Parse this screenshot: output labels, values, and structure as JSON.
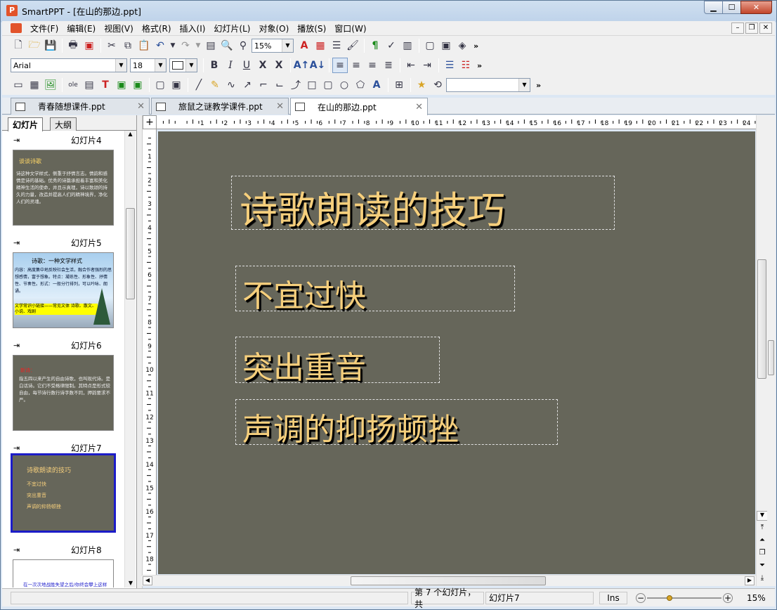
{
  "window": {
    "title": "SmartPPT - [在山的那边.ppt]",
    "app_icon": "P"
  },
  "caption_buttons": {
    "minimize": "▁",
    "maximize": "☐",
    "close": "✕"
  },
  "mdi_controls": [
    "–",
    "❐",
    "✕"
  ],
  "menu": [
    "文件(F)",
    "编辑(E)",
    "视图(V)",
    "格式(R)",
    "插入(I)",
    "幻灯片(L)",
    "对象(O)",
    "播放(S)",
    "窗口(W)"
  ],
  "toolbar": {
    "zoom": "15%",
    "font": "Arial",
    "size": "18",
    "more": "»"
  },
  "doc_tabs": [
    "青春随想课件.ppt",
    "旅鼠之谜教学课件.ppt",
    "在山的那边.ppt"
  ],
  "panel_tabs": [
    "幻灯片",
    "大纲"
  ],
  "slides": [
    {
      "label": "幻灯片4",
      "title": "谈谈诗歌",
      "body": "诗这种文学样式，侧重于抒情言志。情韵和感情是诗的基础。优秀的诗篇承担着丰富和美化精神生活的使命，并且示真理，诗以歌颂的持久的力量，改造并提高人们的精神境界，净化人们的灵魂。"
    },
    {
      "label": "幻灯片5",
      "title": "诗歌：一种文学样式",
      "body": "内容：高度集中地反映社会生活，融合作者强烈的思想感情，富于想象。特点：凝练性、形象性、抒情性、节奏性。形式：一般分行排列，可以吟咏、朗诵。",
      "highlight": "文学常识小链接——常见文体 诗歌、散文、小说、戏剧"
    },
    {
      "label": "幻灯片6",
      "title": "新诗：",
      "body": "指五四以来产生的自由诗歌，也叫现代诗。是白话诗。它们不受格律限制。其特点是形式较自由，每节诗行数行诗字数不同，押韵要求不严。"
    },
    {
      "label": "幻灯片7",
      "title": "诗歌朗读的技巧",
      "items": [
        "不宜过快",
        "突出重音",
        "声调的抑扬顿挫"
      ]
    },
    {
      "label": "幻灯片8",
      "body": "在一次次地战胜失望之后/你终会攀上这样一座山顶/而在这座山顶"
    }
  ],
  "slide": {
    "title": "诗歌朗读的技巧",
    "items": [
      "不宜过快",
      "突出重音",
      "声调的抑扬顿挫"
    ]
  },
  "status": {
    "slide_info": "第 7 个幻灯片，共",
    "slide_name": "幻灯片7",
    "mode": "Ins",
    "zoom": "15%",
    "zoom_minus": "−",
    "zoom_plus": "+"
  },
  "colors": {
    "slide_bg": "#66665a",
    "slide_text": "#f6cf7c",
    "selection": "#1c1cc8"
  }
}
